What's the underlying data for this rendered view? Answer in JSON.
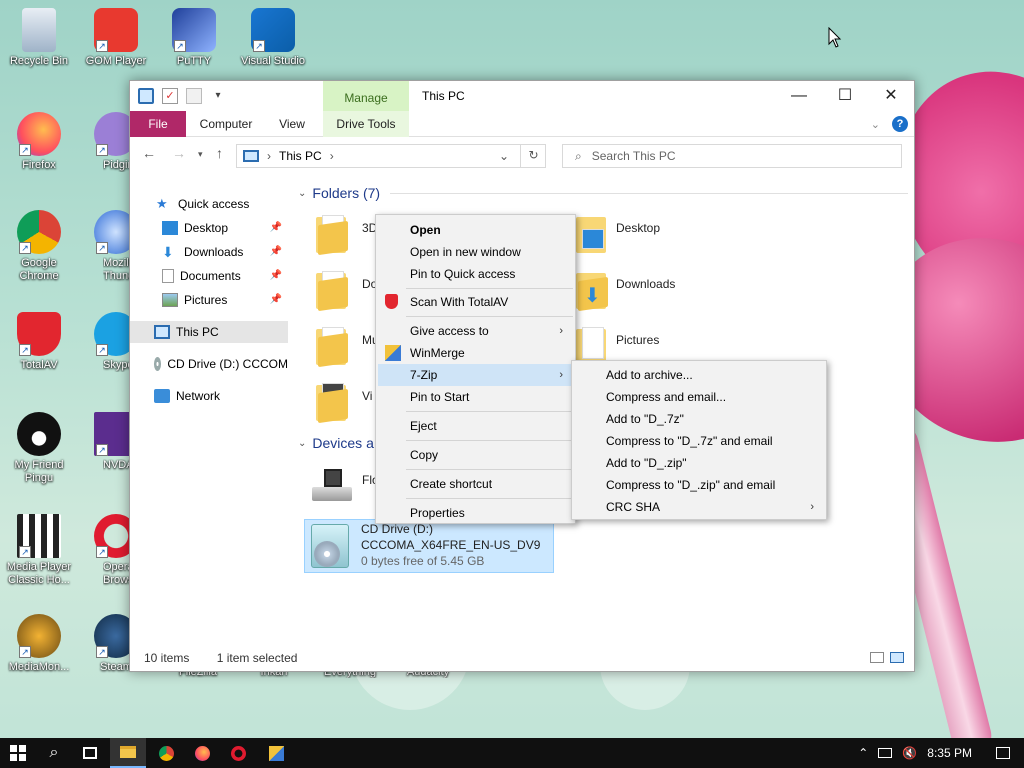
{
  "desktop": {
    "icons": [
      {
        "label": "Recycle Bin"
      },
      {
        "label": "GOM Player"
      },
      {
        "label": "PuTTY"
      },
      {
        "label": "Visual Studio Code"
      },
      {
        "label": "Firefox"
      },
      {
        "label": "Pidgin"
      },
      {
        "label": "Google Chrome"
      },
      {
        "label": "Mozilla Thunderbird"
      },
      {
        "label": "TotalAV"
      },
      {
        "label": "Skype"
      },
      {
        "label": "My Friend Pingu"
      },
      {
        "label": "NVDA"
      },
      {
        "label": "Media Player Classic Ho..."
      },
      {
        "label": "Opera Browser"
      },
      {
        "label": "MediaMon..."
      },
      {
        "label": "Steam"
      }
    ],
    "bottom_labels": [
      "FileZilla",
      "Inkari",
      "Everything",
      "Audacity"
    ]
  },
  "window": {
    "title": "This PC",
    "manage_tab": "Manage",
    "tabs": {
      "file": "File",
      "computer": "Computer",
      "view": "View",
      "drive_tools": "Drive Tools"
    },
    "address": "This PC",
    "search_placeholder": "Search This PC",
    "nav": {
      "quick_access": "Quick access",
      "desktop": "Desktop",
      "downloads": "Downloads",
      "documents": "Documents",
      "pictures": "Pictures",
      "this_pc": "This PC",
      "cd_drive": "CD Drive (D:) CCCOM",
      "network": "Network"
    },
    "folders_header": "Folders (7)",
    "folders": [
      "3D",
      "Do",
      "Mu",
      "Vi",
      "Desktop",
      "Downloads",
      "Pictures"
    ],
    "devices_header": "Devices a",
    "floppy": "Flo",
    "cd": {
      "name": "CD Drive (D:)",
      "label": "CCCOMA_X64FRE_EN-US_DV9",
      "space": "0 bytes free of 5.45 GB"
    },
    "status": {
      "items": "10 items",
      "selected": "1 item selected"
    }
  },
  "context_menu": {
    "items": {
      "open": "Open",
      "open_new_window": "Open in new window",
      "pin_quick": "Pin to Quick access",
      "scan": "Scan With TotalAV",
      "give_access": "Give access to",
      "winmerge": "WinMerge",
      "sevenzip": "7-Zip",
      "pin_start": "Pin to Start",
      "eject": "Eject",
      "copy": "Copy",
      "shortcut": "Create shortcut",
      "properties": "Properties"
    }
  },
  "submenu": {
    "items": {
      "add_archive": "Add to archive...",
      "compress_email": "Compress and email...",
      "add_7z": "Add to \"D_.7z\"",
      "compress_7z_email": "Compress to \"D_.7z\" and email",
      "add_zip": "Add to \"D_.zip\"",
      "compress_zip_email": "Compress to \"D_.zip\" and email",
      "crc": "CRC SHA"
    }
  },
  "taskbar": {
    "time": "8:35 PM"
  },
  "colors": {
    "file_tab": "#b02868",
    "manage_tab": "#d8f3c5",
    "selection": "#cce8ff",
    "menu_highlight": "#cfe4f7"
  }
}
